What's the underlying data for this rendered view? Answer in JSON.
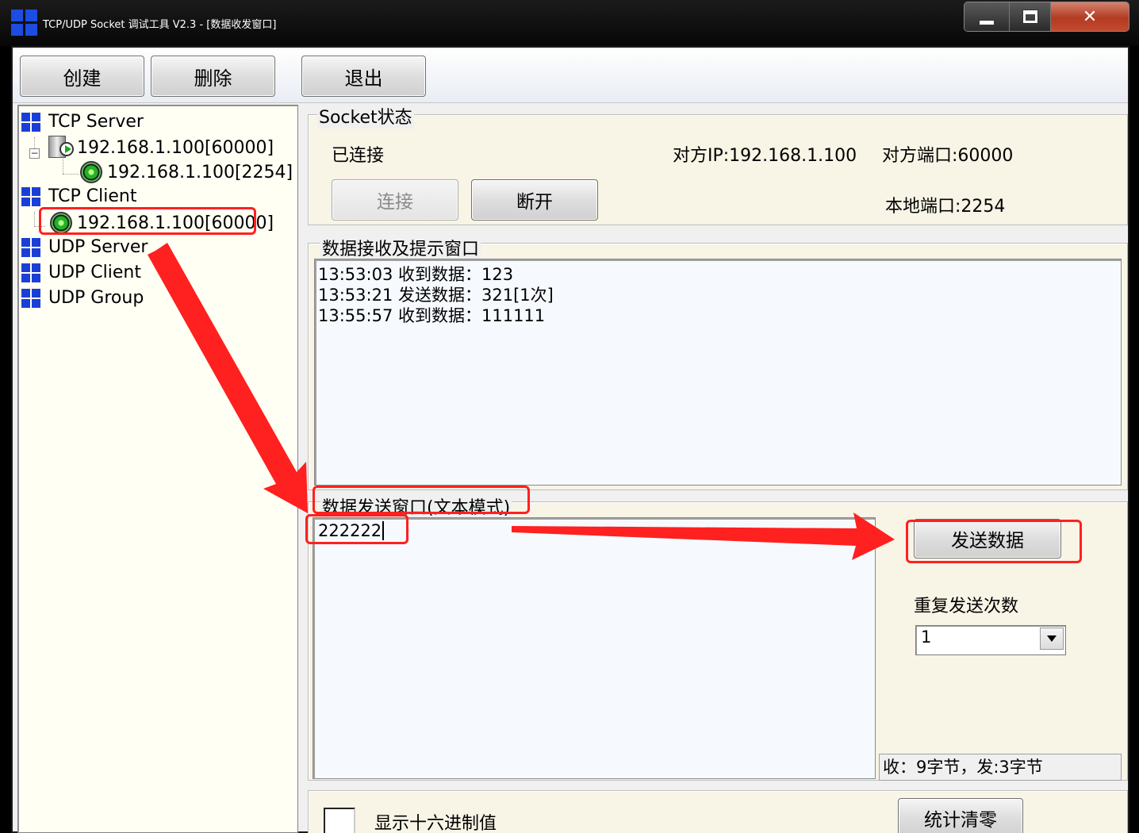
{
  "window": {
    "title": "TCP/UDP Socket 调试工具 V2.3 - [数据收发窗口]"
  },
  "toolbar": {
    "create_label": "创建",
    "delete_label": "删除",
    "exit_label": "退出"
  },
  "tree": {
    "tcp_server_label": "TCP Server",
    "tcp_server_listen": "192.168.1.100[60000]",
    "tcp_server_peer": "192.168.1.100[2254]",
    "tcp_client_label": "TCP Client",
    "tcp_client_conn": "192.168.1.100[60000]",
    "udp_server_label": "UDP Server",
    "udp_client_label": "UDP Client",
    "udp_group_label": "UDP Group"
  },
  "socket_status": {
    "title": "Socket状态",
    "state": "已连接",
    "remote_ip": "对方IP:192.168.1.100",
    "remote_port": "对方端口:60000",
    "local_port": "本地端口:2254",
    "connect_label": "连接",
    "disconnect_label": "断开"
  },
  "receive": {
    "title": "数据接收及提示窗口",
    "lines": [
      "13:53:03 收到数据：123",
      "13:53:21 发送数据：321[1次]",
      "13:55:57 收到数据：111111"
    ]
  },
  "send": {
    "title": "数据发送窗口(文本模式)",
    "value": "222222",
    "send_label": "发送数据",
    "repeat_label": "重复发送次数",
    "repeat_value": "1",
    "stats": "收：9字节，发:3字节"
  },
  "bottom": {
    "hex_label": "显示十六进制值",
    "reset_label": "统计清零"
  },
  "colors": {
    "annotation": "#ff2020",
    "tree_icon": "#1b3fd6"
  }
}
